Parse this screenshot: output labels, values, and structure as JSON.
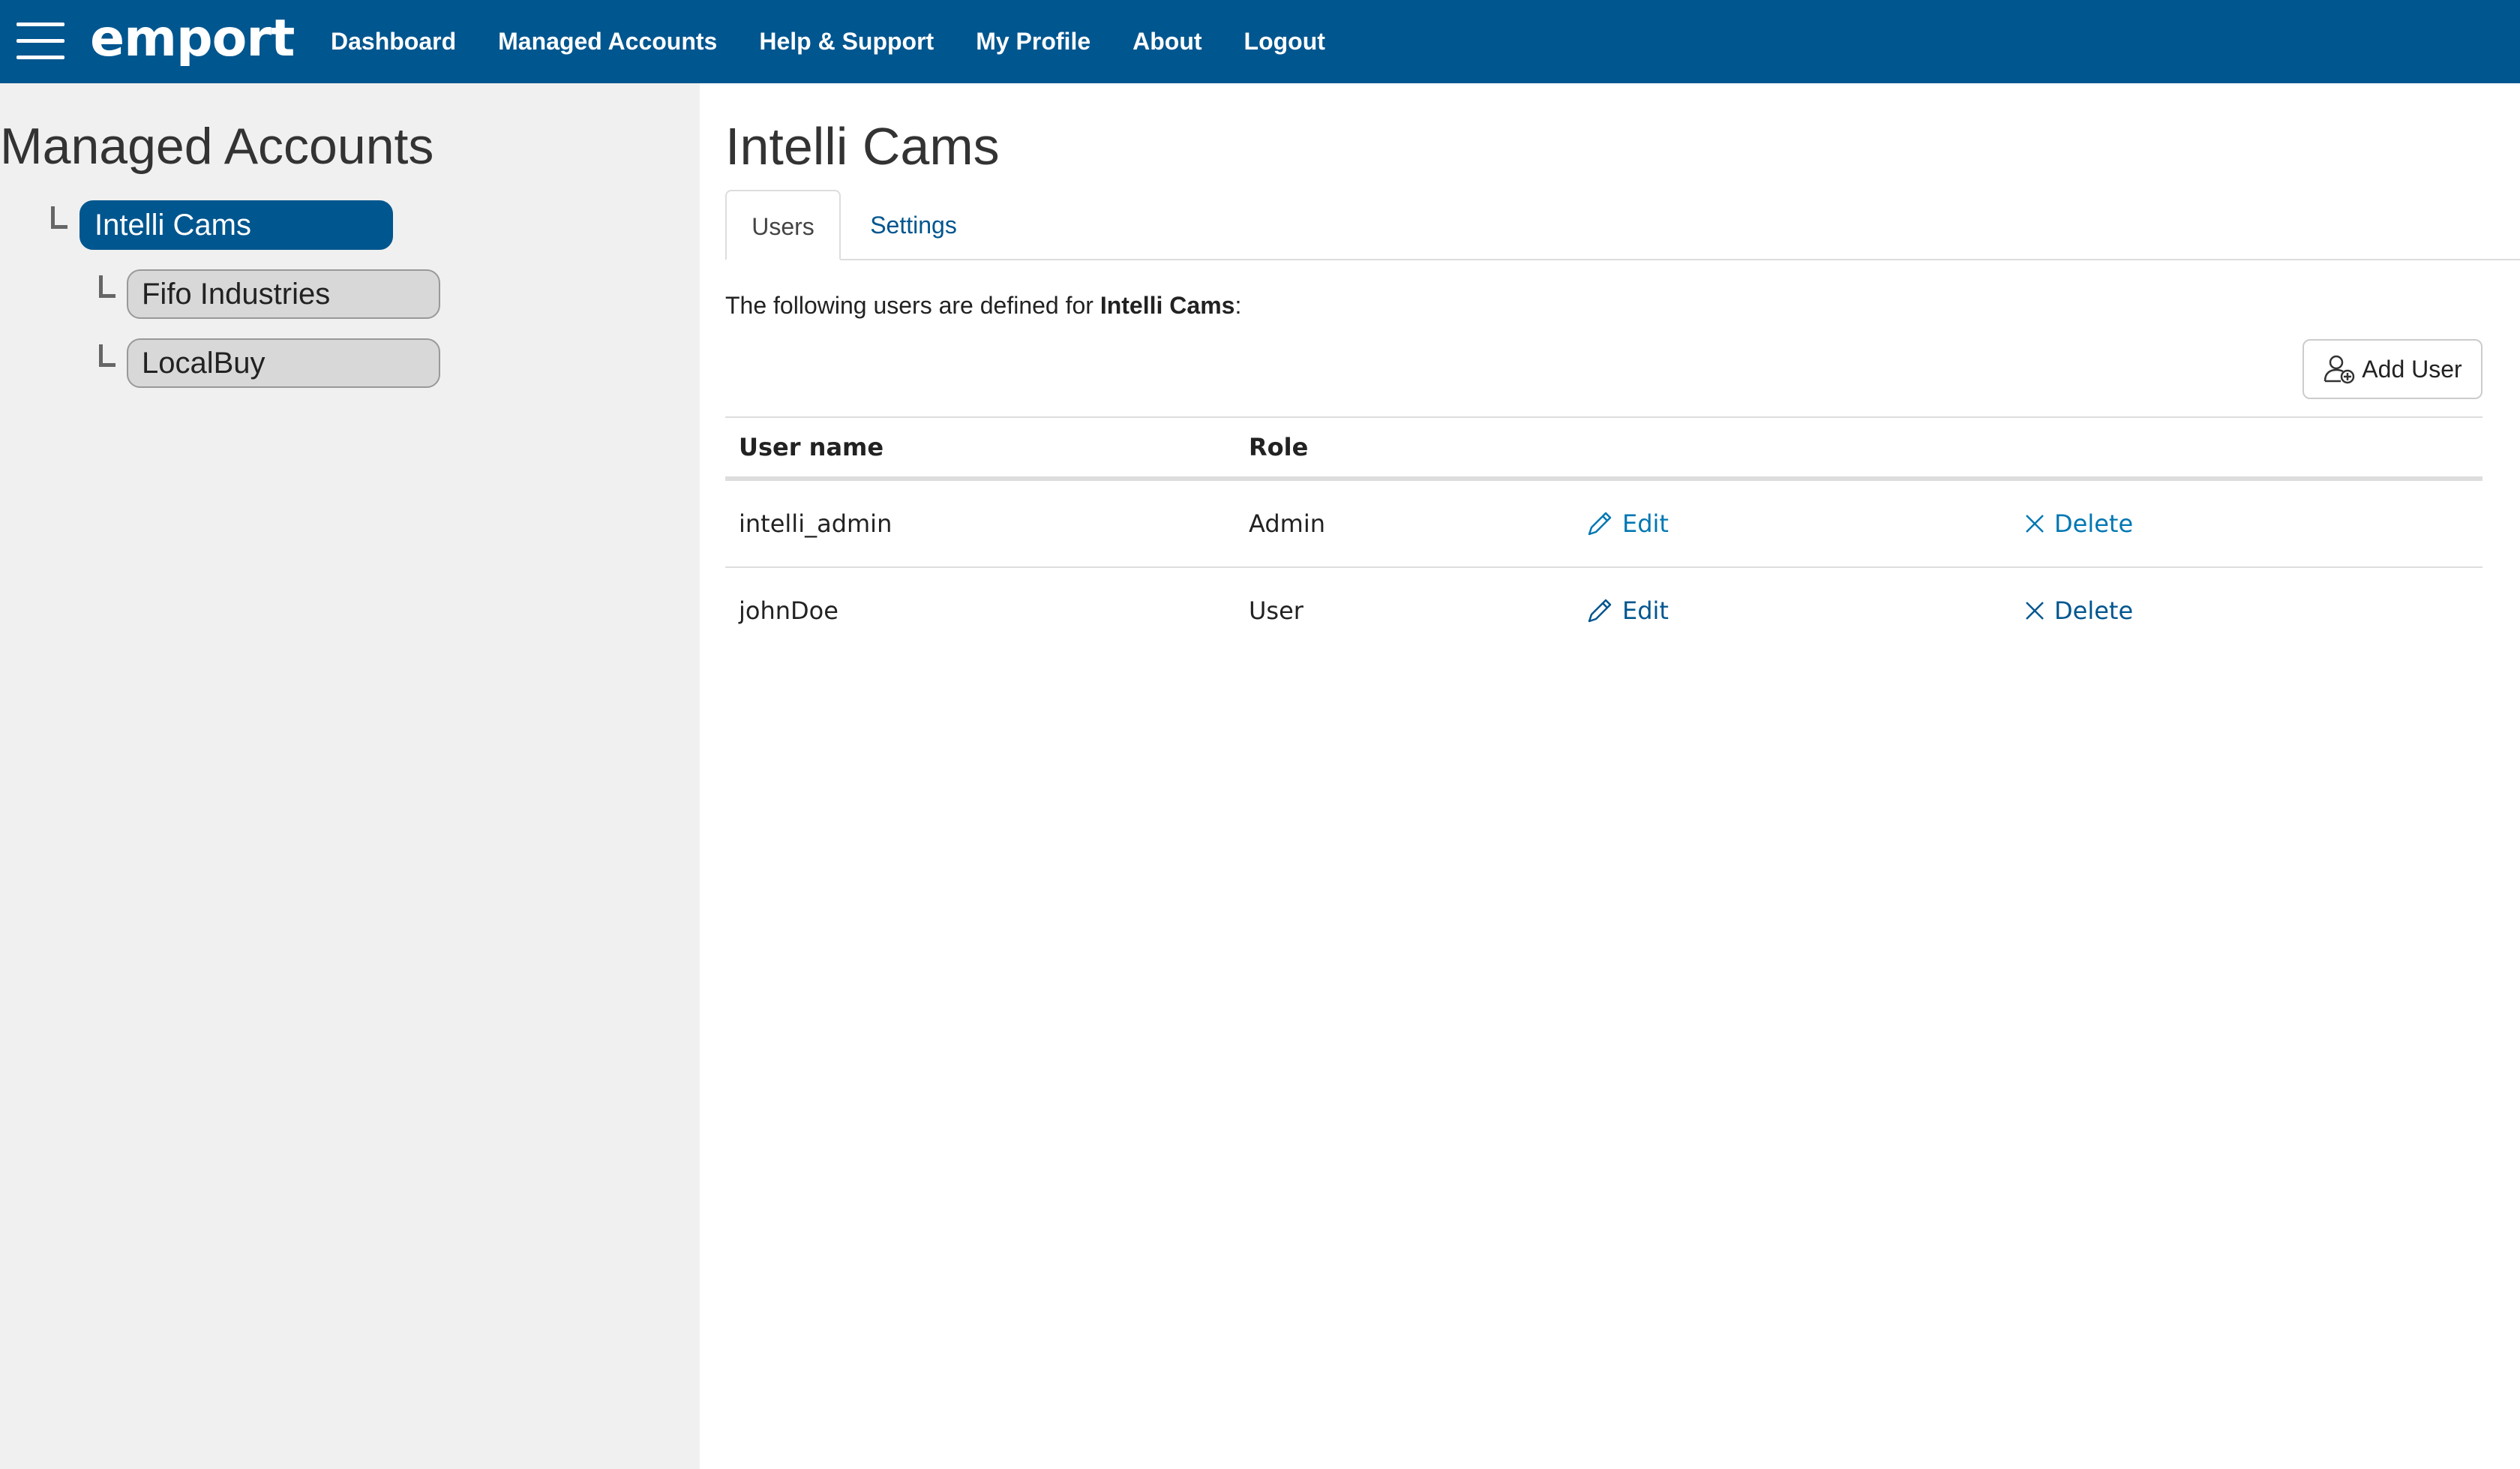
{
  "brand": {
    "logo_text": "emport",
    "bar_color": "#00568f"
  },
  "nav": {
    "items": [
      "Dashboard",
      "Managed Accounts",
      "Help & Support",
      "My Profile",
      "About",
      "Logout"
    ]
  },
  "sidebar": {
    "title": "Managed Accounts",
    "tree": [
      {
        "label": "Intelli Cams",
        "active": true
      },
      {
        "label": "Fifo Industries",
        "active": false
      },
      {
        "label": "LocalBuy",
        "active": false
      }
    ]
  },
  "main": {
    "title": "Intelli Cams",
    "tabs": [
      "Users",
      "Settings"
    ],
    "intro_prefix": "The following users are defined for ",
    "intro_account": "Intelli Cams",
    "intro_suffix": ":",
    "add_user_label": "Add User",
    "table": {
      "headers": [
        "User name",
        "Role"
      ],
      "rows": [
        {
          "username": "intelli_admin",
          "role": "Admin",
          "edit": "Edit",
          "delete": "Delete"
        },
        {
          "username": "johnDoe",
          "role": "User",
          "edit": "Edit",
          "delete": "Delete"
        }
      ]
    }
  }
}
